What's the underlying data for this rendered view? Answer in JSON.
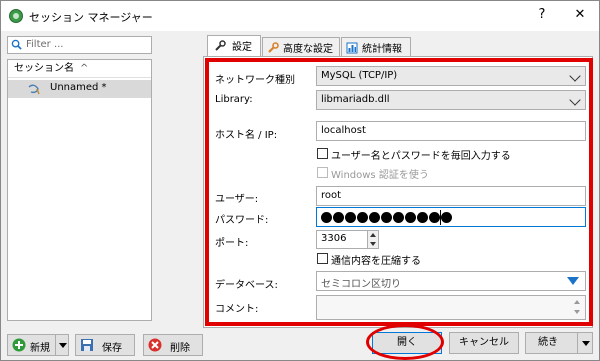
{
  "window": {
    "title": "セッション マネージャー",
    "help_glyph": "?",
    "close_glyph": "✕"
  },
  "sidebar": {
    "filter_placeholder": "Filter ...",
    "column_header": "セッション名",
    "sort_glyph": "^",
    "sessions": [
      {
        "name": "Unnamed *",
        "selected": true
      }
    ],
    "buttons": {
      "new": "新規",
      "save": "保存",
      "delete": "削除"
    }
  },
  "tabs": [
    {
      "label": "設定",
      "icon": "wrench-icon",
      "active": true
    },
    {
      "label": "高度な設定",
      "icon": "wrench-orange-icon",
      "active": false
    },
    {
      "label": "統計情報",
      "icon": "bar-chart-icon",
      "active": false
    }
  ],
  "settings": {
    "network_type_label": "ネットワーク種別",
    "network_type_value": "MySQL (TCP/IP)",
    "library_label": "Library:",
    "library_value": "libmariadb.dll",
    "host_label": "ホスト名 / IP:",
    "host_value": "localhost",
    "prompt_credentials_label": "ユーザー名とパスワードを毎回入力する",
    "prompt_credentials_checked": false,
    "windows_auth_label": "Windows 認証を使う",
    "windows_auth_checked": false,
    "windows_auth_enabled": false,
    "user_label": "ユーザー:",
    "user_value": "root",
    "password_label": "パスワード:",
    "password_length": 11,
    "port_label": "ポート:",
    "port_value": "3306",
    "compress_label": "通信内容を圧縮する",
    "compress_checked": false,
    "databases_label": "データベース:",
    "databases_placeholder": "セミコロン区切り",
    "comment_label": "コメント:",
    "comment_value": ""
  },
  "footer": {
    "open": "開く",
    "cancel": "キャンセル",
    "more": "続き"
  },
  "colors": {
    "highlight_red": "#e00000",
    "focus_blue": "#0078d7",
    "app_green": "#3a9a4a"
  }
}
